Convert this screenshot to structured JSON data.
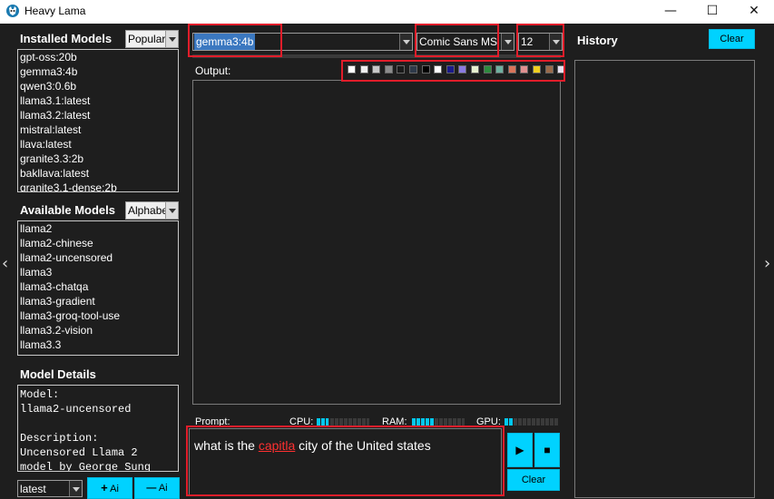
{
  "window": {
    "title": "Heavy Lama",
    "minimize_glyph": "—",
    "maximize_glyph": "☐",
    "close_glyph": "✕"
  },
  "installed": {
    "title": "Installed Models",
    "sort": "Popular",
    "items": [
      "gpt-oss:20b",
      "gemma3:4b",
      "qwen3:0.6b",
      "llama3.1:latest",
      "llama3.2:latest",
      "mistral:latest",
      "llava:latest",
      "granite3.3:2b",
      "bakllava:latest",
      "granite3.1-dense:2b"
    ]
  },
  "available": {
    "title": "Available Models",
    "sort": "Alphabe",
    "items": [
      "llama2",
      "llama2-chinese",
      "llama2-uncensored",
      "llama3",
      "llama3-chatqa",
      "llama3-gradient",
      "llama3-groq-tool-use",
      "llama3.2-vision",
      "llama3.3"
    ]
  },
  "details": {
    "title": "Model Details",
    "lines": [
      "Model:",
      "llama2-uncensored",
      "",
      "Description:",
      "Uncensored Llama 2",
      "model by George Sung"
    ]
  },
  "bottom_left": {
    "version": "latest",
    "add_label": "Ai",
    "remove_label": "Ai",
    "add_glyph": "+",
    "remove_glyph": "—"
  },
  "toolbar": {
    "model": "gemma3:4b",
    "font": "Comic Sans MS",
    "size": "12"
  },
  "output": {
    "label": "Output:",
    "colors": [
      "#ffffff",
      "#f0f0f0",
      "#c8c8c8",
      "#8c8c8c",
      "#1a1a1a",
      "#2f3a4a",
      "#000000",
      "#ffffff",
      "#1a1a8a",
      "#8a7ae0",
      "#e6f0d0",
      "#2e8b3e",
      "#6fb0a0",
      "#d9745a",
      "#e09090",
      "#f0d020",
      "#9a6a4a",
      "#e8e0f0"
    ]
  },
  "status": {
    "prompt_label": "Prompt:",
    "cpu_label": "CPU:",
    "ram_label": "RAM:",
    "gpu_label": "GPU:",
    "cpu_level": 0.22,
    "ram_level": 0.42,
    "gpu_level": 0.15
  },
  "prompt": {
    "before": "what is the ",
    "misspelled": "capitla",
    "after": " city of the United states"
  },
  "controls": {
    "play_glyph": "▶",
    "stop_glyph": "■",
    "clear_label": "Clear"
  },
  "history": {
    "title": "History",
    "clear_label": "Clear"
  },
  "nav": {
    "left_glyph": "‹",
    "right_glyph": "›"
  }
}
